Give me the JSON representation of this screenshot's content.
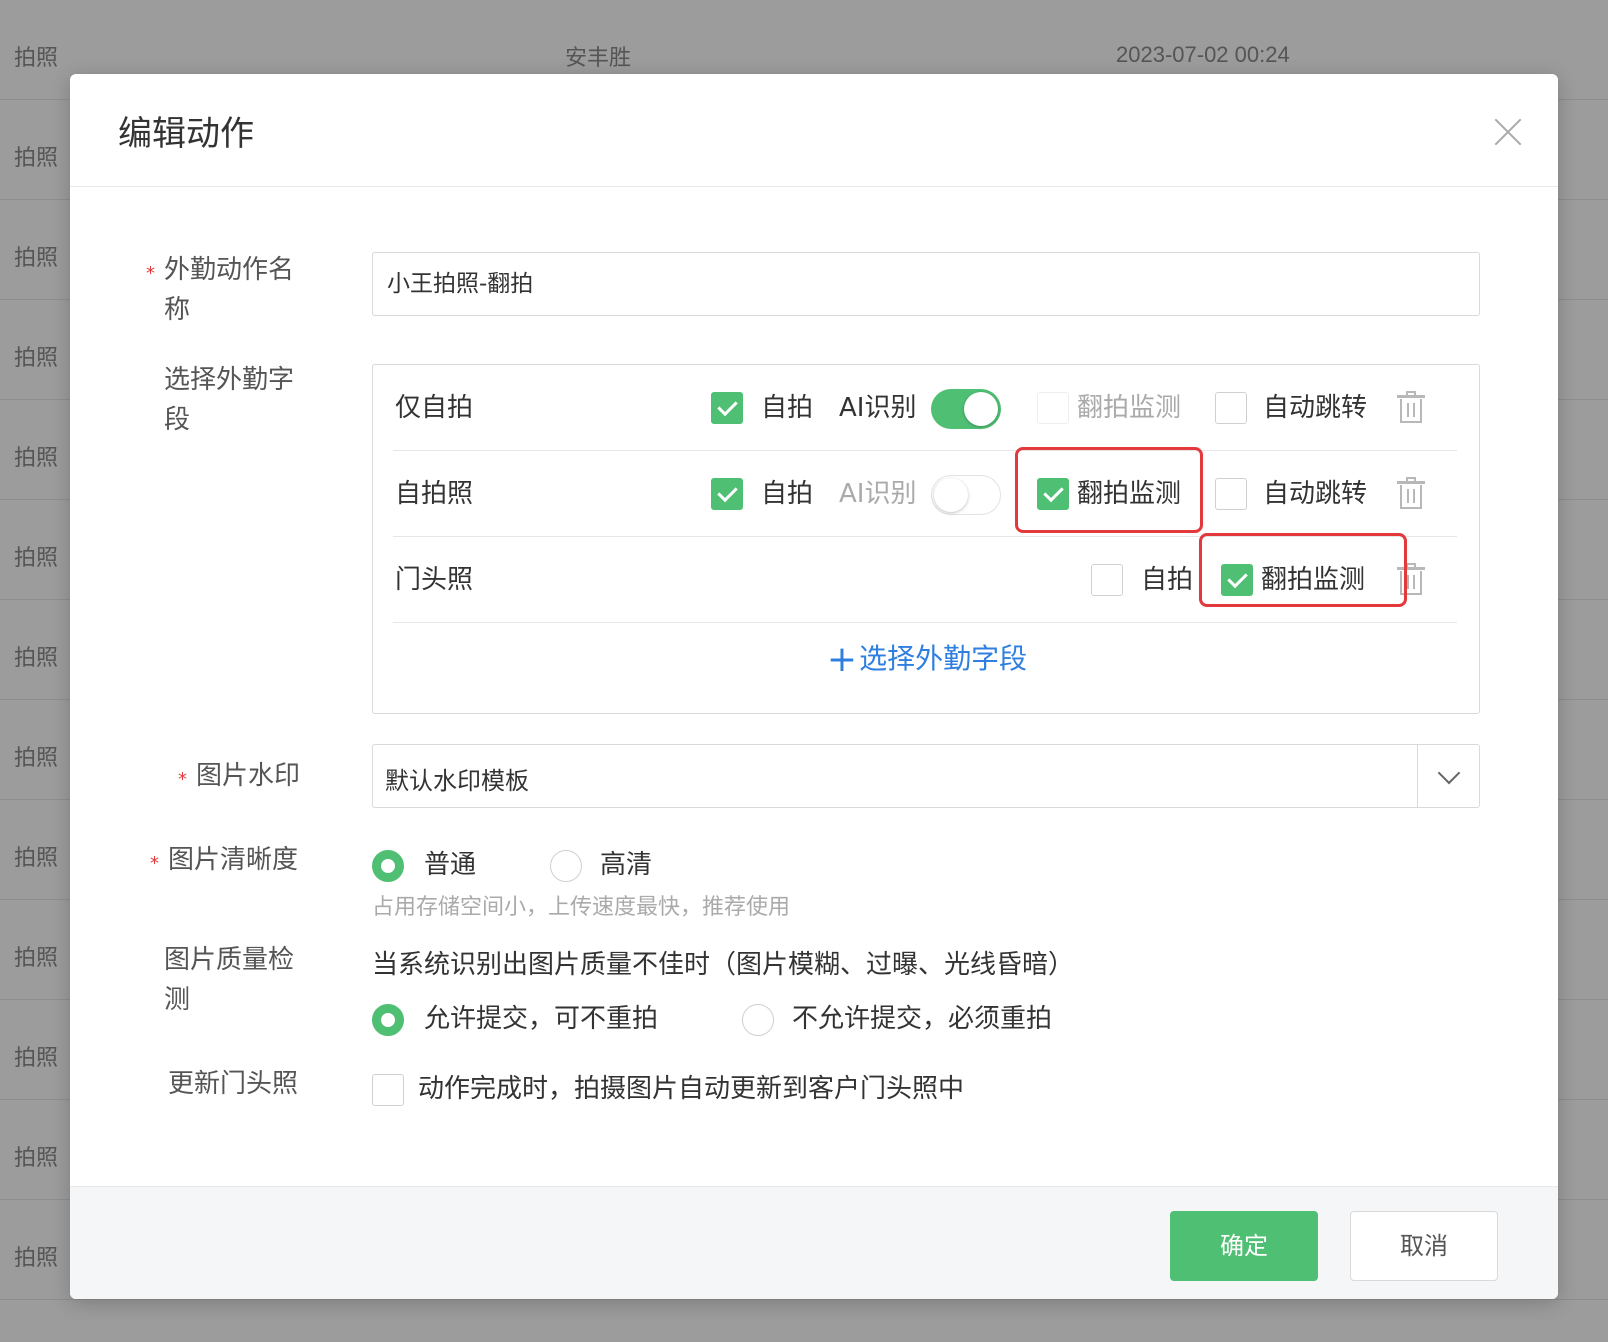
{
  "background": {
    "rows": [
      {
        "type": "拍照",
        "name": "安丰胜",
        "time": "2023-07-02 00:24"
      },
      {
        "type": "拍照",
        "name": "",
        "time": ""
      },
      {
        "type": "拍照",
        "name": "",
        "time": ""
      },
      {
        "type": "拍照",
        "name": "",
        "time": ""
      },
      {
        "type": "拍照",
        "name": "",
        "time": ""
      },
      {
        "type": "拍照",
        "name": "",
        "time": ""
      },
      {
        "type": "拍照",
        "name": "",
        "time": ""
      },
      {
        "type": "拍照",
        "name": "",
        "time": ""
      },
      {
        "type": "拍照",
        "name": "",
        "time": ""
      },
      {
        "type": "拍照",
        "name": "",
        "time": ""
      },
      {
        "type": "拍照",
        "name": "",
        "time": ""
      },
      {
        "type": "拍照",
        "name": "",
        "time": ""
      },
      {
        "type": "拍照",
        "name": "",
        "time": ""
      }
    ]
  },
  "modal": {
    "title": "编辑动作",
    "action_name": {
      "label_line1": "外勤动作名",
      "label_line2": "称",
      "value": "小王拍照-翻拍"
    },
    "fields": {
      "label_line1": "选择外勤字",
      "label_line2": "段",
      "rows": [
        {
          "name": "仅自拍",
          "selfie_label": "自拍",
          "ai_label": "AI识别",
          "recapture_label": "翻拍监测",
          "autojump_label": "自动跳转"
        },
        {
          "name": "自拍照",
          "selfie_label": "自拍",
          "ai_label": "AI识别",
          "recapture_label": "翻拍监测",
          "autojump_label": "自动跳转"
        },
        {
          "name": "门头照",
          "selfie_label": "自拍",
          "recapture_label": "翻拍监测"
        }
      ],
      "add_label": "选择外勤字段"
    },
    "watermark": {
      "label": "图片水印",
      "value": "默认水印模板"
    },
    "clarity": {
      "label": "图片清晰度",
      "option_normal": "普通",
      "option_hd": "高清",
      "hint": "占用存储空间小，上传速度最快，推荐使用"
    },
    "quality": {
      "label_line1": "图片质量检",
      "label_line2": "测",
      "text": "当系统识别出图片质量不佳时（图片模糊、过曝、光线昏暗）",
      "option_allow": "允许提交，可不重拍",
      "option_deny": "不允许提交，必须重拍"
    },
    "update_photo": {
      "label": "更新门头照",
      "text": "动作完成时，拍摄图片自动更新到客户门头照中"
    },
    "footer": {
      "ok": "确定",
      "cancel": "取消"
    }
  },
  "colors": {
    "accent": "#4fbf73",
    "link": "#2f7fe0",
    "highlight": "#e4393c"
  }
}
